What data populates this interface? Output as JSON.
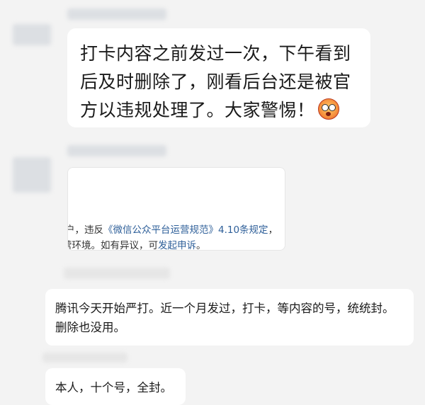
{
  "messages": {
    "first": {
      "line1": "打卡内容之前发过一次，下午看到",
      "line2": "后及时删除了，刚看后台还是被官",
      "line3": "方以违规处理了。大家警惕！",
      "emoji": "astonished-face-icon"
    },
    "notice_card": {
      "line1_prefix": "户，违反",
      "line1_link": "《微信公众平台运营规范》4.10条规定",
      "line1_suffix": "，",
      "line2_prefix": "营环境。如有异议，可",
      "line2_link": "发起申诉",
      "line2_suffix": "。"
    },
    "second": {
      "line1": "腾讯今天开始严打。近一个月发过，打卡，等内容的号，统统封。",
      "line2": "删除也没用。"
    },
    "third": {
      "text": "本人，十个号，全封。"
    }
  },
  "colors": {
    "background": "#f3f3f3",
    "bubble": "#ffffff",
    "link": "#2e5f99"
  }
}
